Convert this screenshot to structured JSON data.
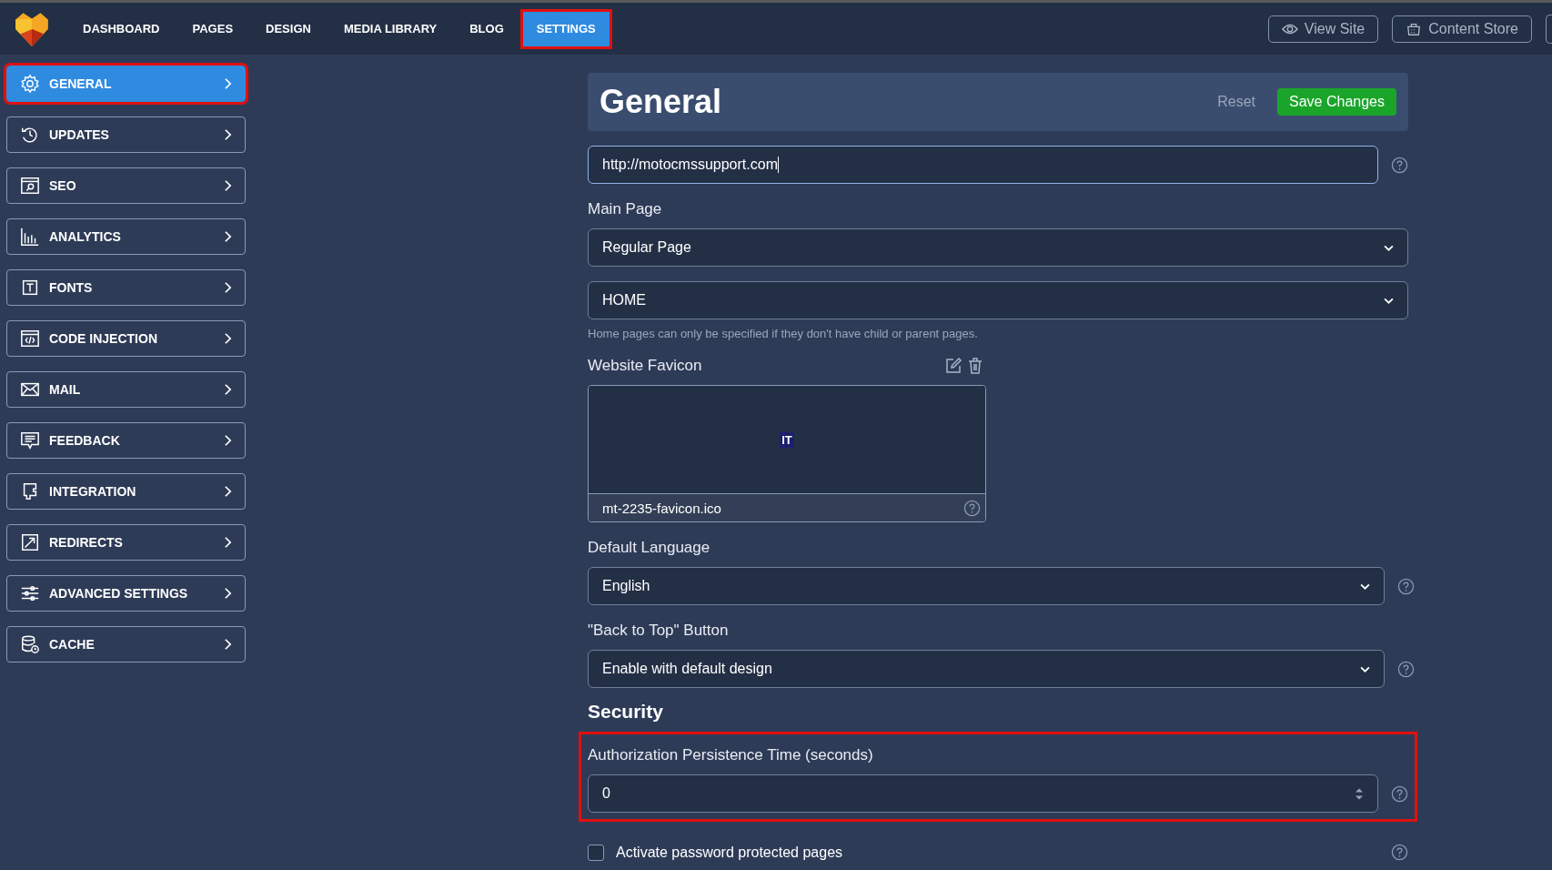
{
  "nav": {
    "items": [
      {
        "label": "DASHBOARD",
        "selected": false,
        "highlighted": false
      },
      {
        "label": "PAGES",
        "selected": false,
        "highlighted": false
      },
      {
        "label": "DESIGN",
        "selected": false,
        "highlighted": false
      },
      {
        "label": "MEDIA LIBRARY",
        "selected": false,
        "highlighted": false
      },
      {
        "label": "BLOG",
        "selected": false,
        "highlighted": false
      },
      {
        "label": "SETTINGS",
        "selected": true,
        "highlighted": true
      }
    ],
    "actions": [
      "View Site",
      "Content Store"
    ]
  },
  "sidebar": {
    "items": [
      {
        "label": "GENERAL",
        "selected": true,
        "highlighted": true
      },
      {
        "label": "UPDATES",
        "selected": false,
        "highlighted": false
      },
      {
        "label": "SEO",
        "selected": false,
        "highlighted": false
      },
      {
        "label": "ANALYTICS",
        "selected": false,
        "highlighted": false
      },
      {
        "label": "FONTS",
        "selected": false,
        "highlighted": false
      },
      {
        "label": "CODE INJECTION",
        "selected": false,
        "highlighted": false
      },
      {
        "label": "MAIL",
        "selected": false,
        "highlighted": false
      },
      {
        "label": "FEEDBACK",
        "selected": false,
        "highlighted": false
      },
      {
        "label": "INTEGRATION",
        "selected": false,
        "highlighted": false
      },
      {
        "label": "REDIRECTS",
        "selected": false,
        "highlighted": false
      },
      {
        "label": "ADVANCED SETTINGS",
        "selected": false,
        "highlighted": false
      },
      {
        "label": "CACHE",
        "selected": false,
        "highlighted": false
      }
    ]
  },
  "panel": {
    "title": "General",
    "reset": "Reset",
    "save": "Save Changes"
  },
  "fields": [
    {
      "kind": "text",
      "value": "http://motocmssupport.com",
      "help": true,
      "highlighted": false
    },
    {
      "kind": "select",
      "label": "Main Page",
      "value": "Regular Page",
      "help": false,
      "highlighted": false
    },
    {
      "kind": "select",
      "value": "HOME",
      "hint": "Home pages can only be specified if they don't have child or parent pages.",
      "help": false,
      "highlighted": false
    },
    {
      "kind": "favicon",
      "label": "Website Favicon",
      "preview": "IT",
      "filename": "mt-2235-favicon.ico",
      "help": true,
      "highlighted": false
    },
    {
      "kind": "select",
      "label": "Default Language",
      "value": "English",
      "help": true,
      "highlighted": false
    },
    {
      "kind": "select",
      "label": "\"Back to Top\" Button",
      "value": "Enable with default design",
      "help": true,
      "highlighted": false
    },
    {
      "kind": "heading",
      "label": "Security",
      "highlighted": false
    },
    {
      "kind": "number",
      "label": "Authorization Persistence Time (seconds)",
      "value": "0",
      "help": true,
      "highlighted": true
    },
    {
      "kind": "checkbox",
      "label": "Activate password protected pages",
      "checked": false,
      "help": true,
      "highlighted": false
    }
  ]
}
